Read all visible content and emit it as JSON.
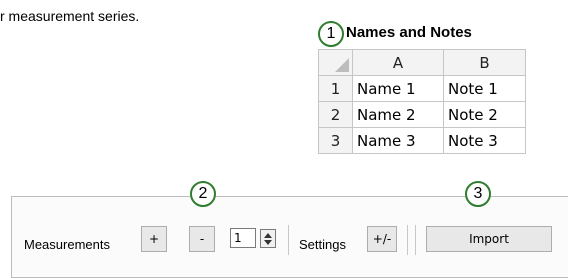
{
  "intro": {
    "text": "r measurement series."
  },
  "callouts": [
    "1",
    "2",
    "3"
  ],
  "names_panel": {
    "title": "Names and Notes",
    "columns": [
      "A",
      "B"
    ],
    "rows": [
      {
        "num": "1",
        "a": "Name 1",
        "b": "Note 1"
      },
      {
        "num": "2",
        "a": "Name 2",
        "b": "Note 2"
      },
      {
        "num": "3",
        "a": "Name 3",
        "b": "Note 3"
      }
    ]
  },
  "toolbar": {
    "measurements_label": "Measurements",
    "add_label": "+",
    "remove_label": "-",
    "count_value": "1",
    "settings_label": "Settings",
    "toggle_label": "+/-",
    "import_label": "Import"
  },
  "colors": {
    "callout_border": "#2f7d2f",
    "header_bg": "#f3f3f3",
    "grid": "#c6c6c6"
  }
}
